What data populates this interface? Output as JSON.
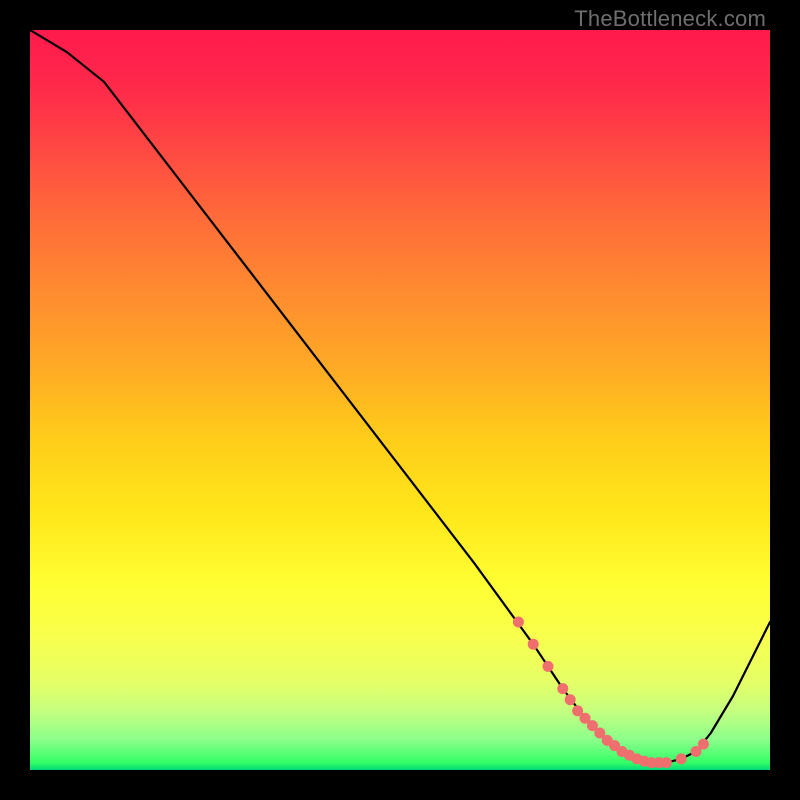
{
  "watermark": "TheBottleneck.com",
  "chart_data": {
    "type": "line",
    "title": "",
    "xlabel": "",
    "ylabel": "",
    "xlim": [
      0,
      100
    ],
    "ylim": [
      0,
      100
    ],
    "series": [
      {
        "name": "bottleneck-curve",
        "x": [
          0,
          5,
          10,
          20,
          30,
          40,
          50,
          60,
          68,
          72,
          75,
          78,
          80,
          82,
          84,
          86,
          88,
          90,
          92,
          95,
          100
        ],
        "y": [
          100,
          97,
          93,
          80,
          67,
          54,
          41,
          28,
          17,
          11,
          7,
          4,
          2.5,
          1.5,
          1,
          1,
          1.5,
          2.5,
          5,
          10,
          20
        ]
      }
    ],
    "markers": {
      "name": "highlight-points",
      "color": "#ef6e6e",
      "x": [
        66,
        68,
        70,
        72,
        73,
        74,
        75,
        76,
        77,
        78,
        79,
        80,
        81,
        82,
        83,
        84,
        85,
        86,
        88,
        90,
        91
      ],
      "y": [
        20,
        17,
        14,
        11,
        9.5,
        8,
        7,
        6,
        5,
        4,
        3.3,
        2.5,
        2,
        1.5,
        1.2,
        1,
        1,
        1,
        1.5,
        2.5,
        3.5
      ]
    },
    "gradient_stops": [
      {
        "pos": 0.0,
        "color": "#ff1a4d"
      },
      {
        "pos": 0.25,
        "color": "#ff6a3a"
      },
      {
        "pos": 0.55,
        "color": "#ffcc1a"
      },
      {
        "pos": 0.82,
        "color": "#f8ff4d"
      },
      {
        "pos": 0.96,
        "color": "#8aff8a"
      },
      {
        "pos": 1.0,
        "color": "#00d878"
      }
    ]
  }
}
